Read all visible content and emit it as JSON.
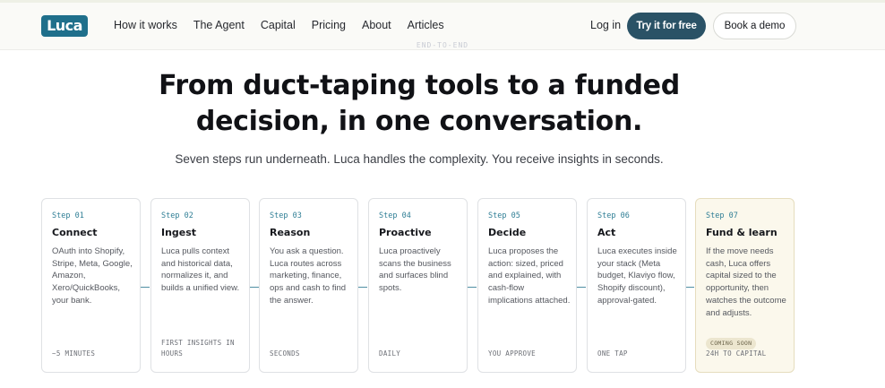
{
  "nav": {
    "logo": "Luca",
    "links": [
      "How it works",
      "The Agent",
      "Capital",
      "Pricing",
      "About",
      "Articles"
    ],
    "login": "Log in",
    "cta_primary": "Try it for free",
    "cta_secondary": "Book a demo"
  },
  "hero": {
    "eyebrow": "END-TO-END",
    "headline_line1": "From duct-taping tools to a funded",
    "headline_line2": "decision, in one conversation.",
    "subheadline": "Seven steps run underneath. Luca handles the complexity. You receive insights in seconds."
  },
  "steps": [
    {
      "num": "Step 01",
      "title": "Connect",
      "desc": "OAuth into Shopify, Stripe, Meta, Google, Amazon, Xero/QuickBooks, your bank.",
      "foot": "~5 MINUTES"
    },
    {
      "num": "Step 02",
      "title": "Ingest",
      "desc": "Luca pulls context and historical data, normalizes it, and builds a unified view.",
      "foot": "FIRST INSIGHTS IN HOURS"
    },
    {
      "num": "Step 03",
      "title": "Reason",
      "desc": "You ask a question. Luca routes across marketing, finance, ops and cash to find the answer.",
      "foot": "SECONDS"
    },
    {
      "num": "Step 04",
      "title": "Proactive",
      "desc": "Luca proactively scans the business and surfaces blind spots.",
      "foot": "DAILY"
    },
    {
      "num": "Step 05",
      "title": "Decide",
      "desc": "Luca proposes the action: sized, priced and explained, with cash-flow implications attached.",
      "foot": "YOU APPROVE"
    },
    {
      "num": "Step 06",
      "title": "Act",
      "desc": "Luca executes inside your stack (Meta budget, Klaviyo flow, Shopify discount), approval-gated.",
      "foot": "ONE TAP"
    },
    {
      "num": "Step 07",
      "title": "Fund & learn",
      "desc": "If the move needs cash, Luca offers capital sized to the opportunity, then watches the outcome and adjusts.",
      "badge": "COMING SOON",
      "foot": "24H TO CAPITAL"
    }
  ],
  "colors": {
    "brand": "#1f6f8b",
    "cta": "#2a5266",
    "step_accent": "#2f7e95",
    "soon_card": "#fbf8ec"
  }
}
